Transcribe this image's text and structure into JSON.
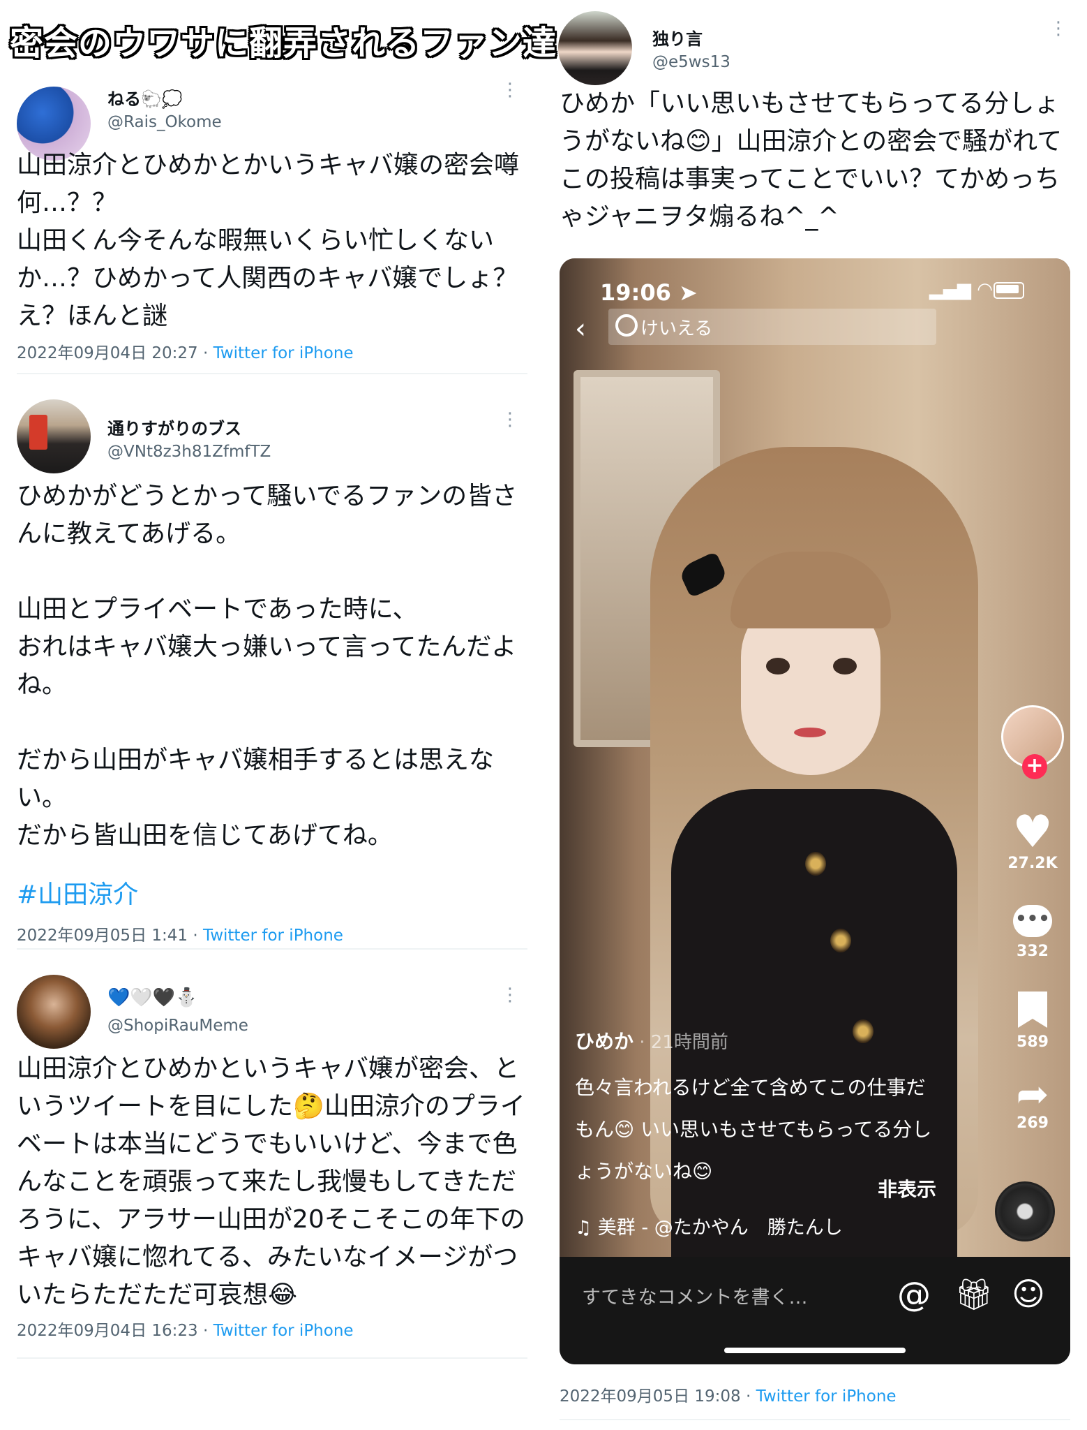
{
  "banner_title": "密会のウワサに翻弄されるファン達",
  "tweets": [
    {
      "name": "ねる🐑💭",
      "handle": "@Rais_Okome",
      "text": "山田涼介とひめかとかいうキャバ嬢の密会噂\n何…？？\n山田くん今そんな暇無いくらい忙しくない\nか…？ひめかって人関西のキャバ嬢でしょ？\nえ？ほんと謎",
      "date": "2022年09月04日 20:27 · ",
      "source": "Twitter for iPhone"
    },
    {
      "name": "通りすがりのブス",
      "handle": "@VNt8z3h81ZfmfTZ",
      "text": "ひめかがどうとかって騒いでるファンの皆さ\nんに教えてあげる。\n\n山田とプライベートであった時に、\nおれはキャバ嬢大っ嫌いって言ってたんだよ\nね。\n\nだから山田がキャバ嬢相手するとは思えな\nい。\nだから皆山田を信じてあげてね。",
      "hashtag": "#山田涼介",
      "date": "2022年09月05日 1:41 · ",
      "source": "Twitter for iPhone"
    },
    {
      "name": "💙🤍🖤⛄",
      "handle": "@ShopiRauMeme",
      "text": "山田涼介とひめかというキャバ嬢が密会、と\nいうツイートを目にした🤔山田涼介のプライ\nベートは本当にどうでもいいけど、今まで色\nんなことを頑張って来たし我慢もしてきただ\nろうに、アラサー山田が20そこそこの年下の\nキャバ嬢に惚れてる、みたいなイメージがつ\nいたらただただ可哀想😂",
      "date": "2022年09月04日 16:23 · ",
      "source": "Twitter for iPhone"
    }
  ],
  "right_tweet": {
    "name": "独り言",
    "handle": "@e5ws13",
    "text": "ひめか「いい思いもさせてもらってる分しょ\nうがないね😊」山田涼介との密会で騒がれて\nこの投稿は事実ってことでいい？てかめっち\nゃジャニヲタ煽るね^_^",
    "date": "2022年09月05日 19:08 · ",
    "source": "Twitter for iPhone"
  },
  "phone": {
    "time": "19:06",
    "search_placeholder": "けいえる",
    "likes": "27.2K",
    "comments": "332",
    "bookmarks": "589",
    "shares": "269",
    "caption_user": "ひめか",
    "caption_time": " · 21時間前",
    "caption_text": "色々言われるけど全て含めてこの仕事だ\nもん😊 いい思いもさせてもらってる分し\nょうがないね😊",
    "hide_label": "非表示",
    "music": "♫ 美群 - @たかやん　勝たんし",
    "comment_placeholder": "すてきなコメントを書く…",
    "menu_dots": "•\n•\n•"
  },
  "colors": {
    "link": "#1d9bf0",
    "secondary_text": "#536471",
    "tiktok_red": "#fe2c55"
  },
  "icons": [
    "more-dots-icon",
    "back-chevron-icon",
    "search-icon",
    "heart-icon",
    "comment-icon",
    "bookmark-icon",
    "share-icon",
    "at-icon",
    "gift-icon",
    "emoji-icon",
    "signal-icon",
    "wifi-icon",
    "battery-icon",
    "music-note-icon"
  ]
}
